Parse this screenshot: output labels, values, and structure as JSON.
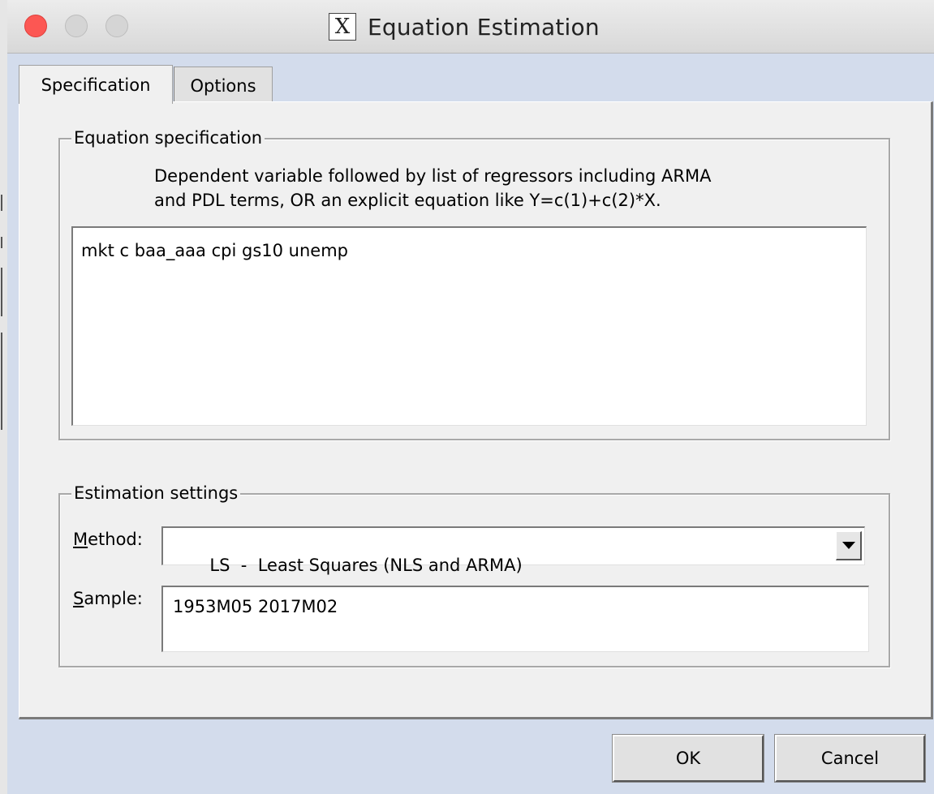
{
  "window": {
    "title": "Equation Estimation",
    "app_icon_glyph": "X",
    "title_bar_buttons": [
      "close",
      "minimize",
      "zoom"
    ]
  },
  "tabs": [
    {
      "label": "Specification",
      "active": true
    },
    {
      "label": "Options",
      "active": false
    }
  ],
  "equation_specification": {
    "legend": "Equation specification",
    "instructions_line1": "Dependent variable followed by list of regressors including ARMA",
    "instructions_line2": "and PDL terms, OR an explicit equation like Y=c(1)+c(2)*X.",
    "value": "mkt c baa_aaa cpi gs10 unemp"
  },
  "estimation_settings": {
    "legend": "Estimation settings",
    "method_label_first": "M",
    "method_label_rest": "ethod:",
    "method_value": "LS  -  Least Squares (NLS and ARMA)",
    "sample_label_first": "S",
    "sample_label_rest": "ample:",
    "sample_value": "1953M05 2017M02"
  },
  "buttons": {
    "ok": "OK",
    "cancel": "Cancel"
  },
  "colors": {
    "window_bg": "#d3dcec",
    "panel_bg": "#f0f0f0",
    "close_red": "#fc5753"
  }
}
